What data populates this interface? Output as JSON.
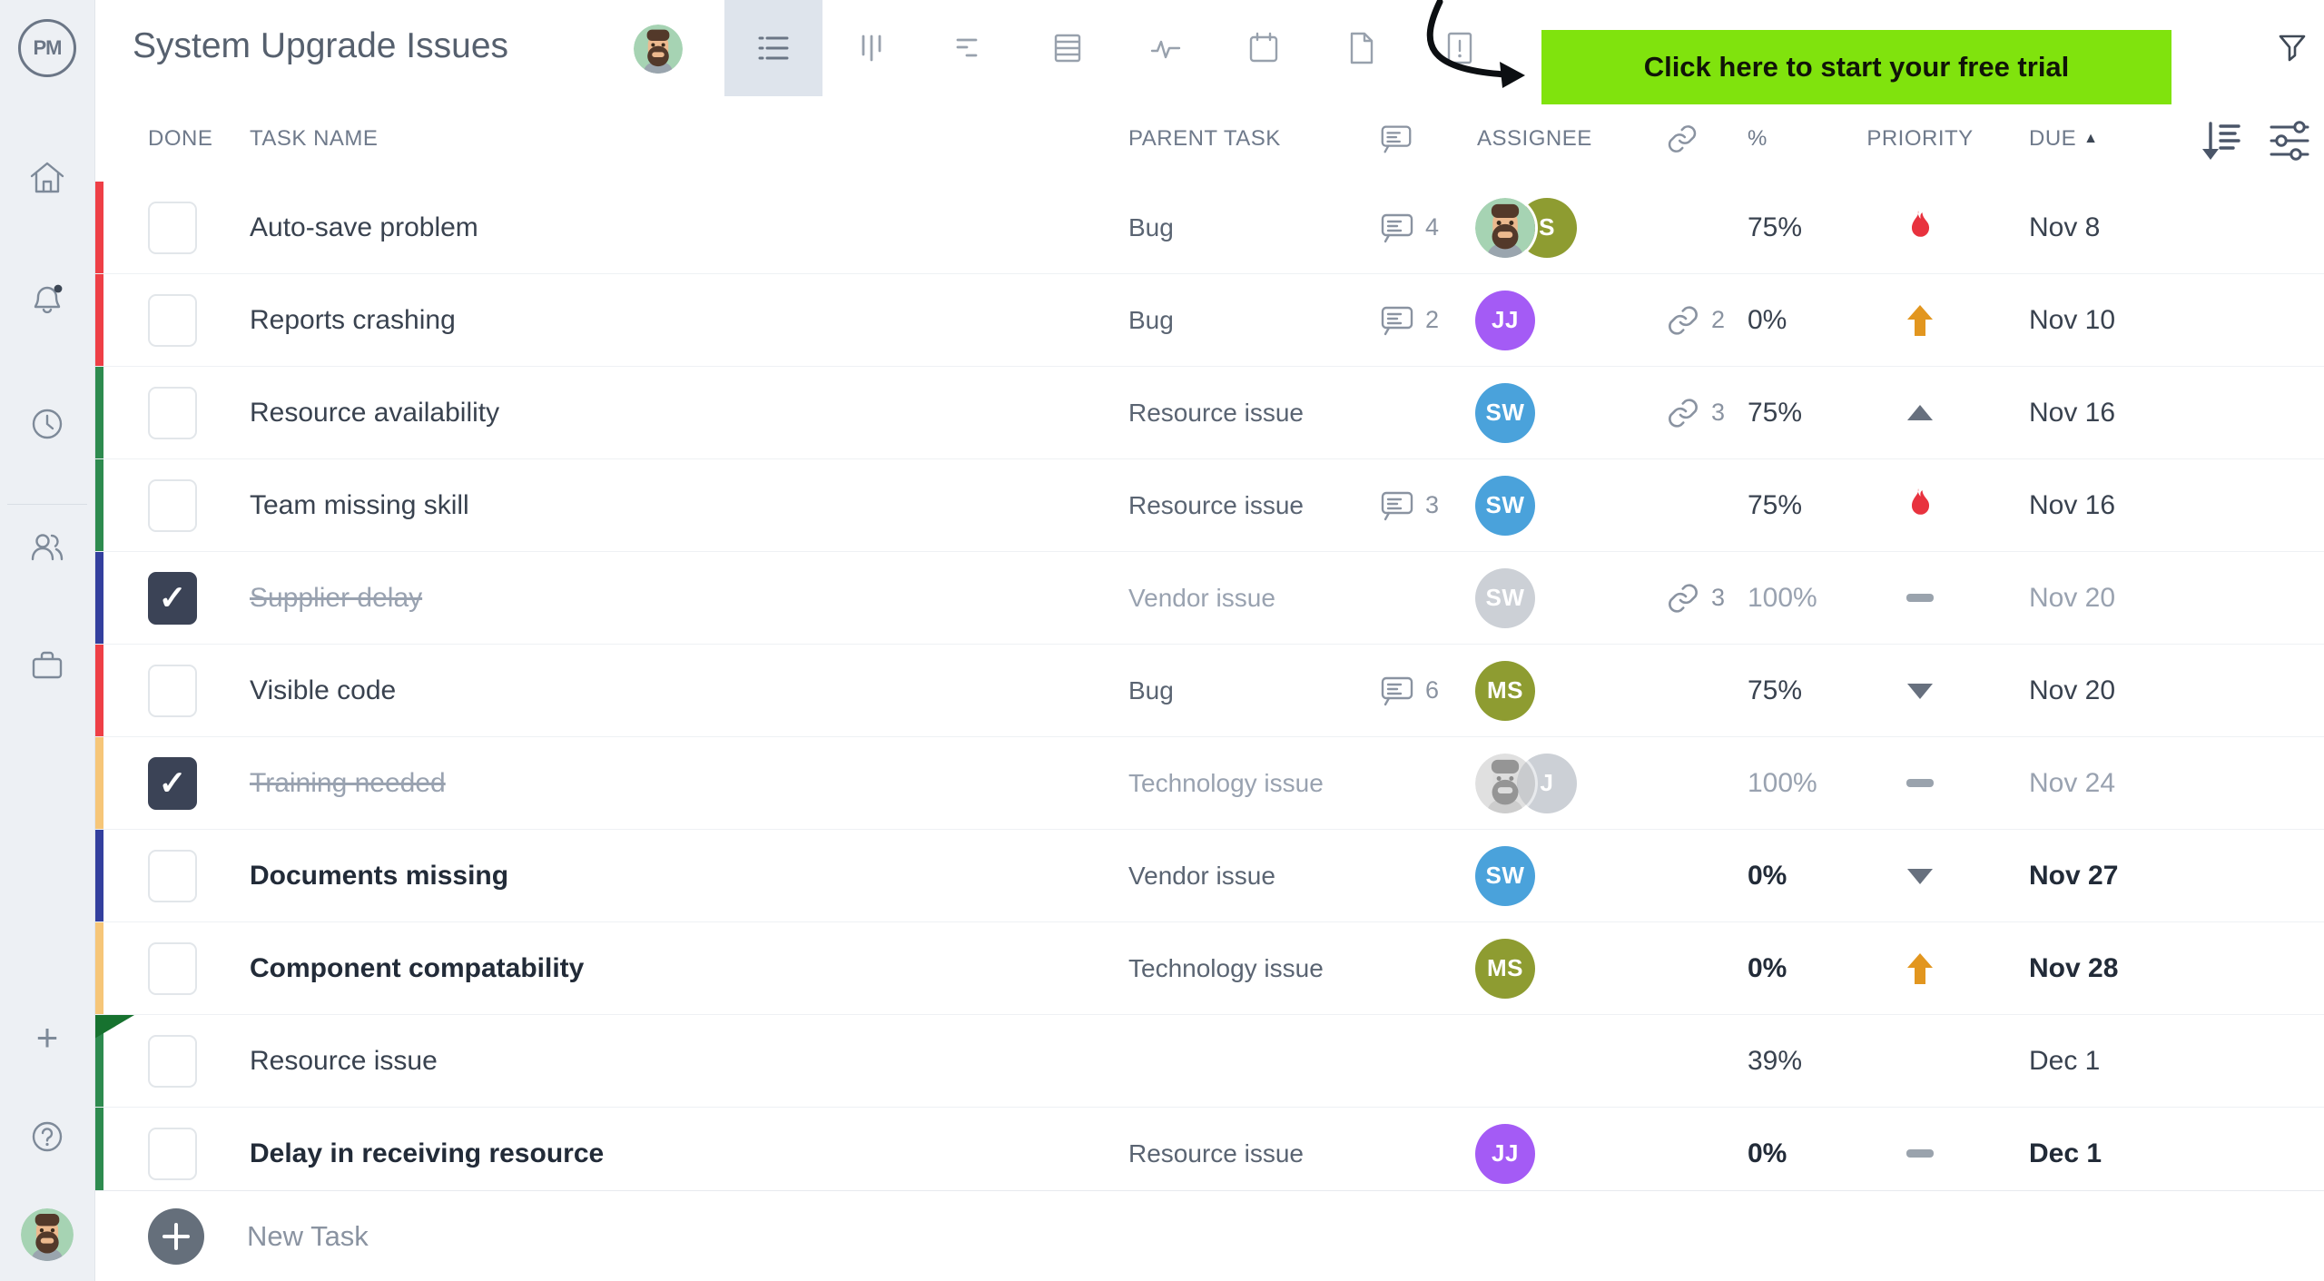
{
  "app": {
    "logo_text": "PM"
  },
  "header": {
    "title": "System Upgrade Issues",
    "banner_label": "Click here to start your free trial",
    "views": [
      {
        "id": "list-view",
        "selected": true
      },
      {
        "id": "board-view",
        "selected": false
      },
      {
        "id": "plan-view",
        "selected": false
      },
      {
        "id": "sheet-view",
        "selected": false
      },
      {
        "id": "activity-view",
        "selected": false
      },
      {
        "id": "calendar-view",
        "selected": false
      },
      {
        "id": "page-view",
        "selected": false
      },
      {
        "id": "issues-view",
        "selected": false
      }
    ]
  },
  "sidebar": {
    "items": [
      "home",
      "notifications",
      "recent",
      "team",
      "portfolio",
      "add",
      "help",
      "profile"
    ]
  },
  "table": {
    "columns": {
      "done": "DONE",
      "task_name": "TASK NAME",
      "parent_task": "PARENT TASK",
      "assignee": "ASSIGNEE",
      "percent": "%",
      "priority": "PRIORITY",
      "due": "DUE"
    },
    "sort": {
      "column": "DUE",
      "direction": "asc"
    },
    "rows": [
      {
        "name": "Auto-save problem",
        "parent": "Bug",
        "done": false,
        "bold": false,
        "bar_color": "#ee3f46",
        "comments": 4,
        "attachments": null,
        "percent": "75%",
        "priority": "urgent",
        "due": "Nov 8",
        "assignees": [
          {
            "kind": "photo",
            "muted": false
          },
          {
            "kind": "initials",
            "text": "S",
            "color": "#8e9c31",
            "muted": false
          }
        ]
      },
      {
        "name": "Reports crashing",
        "parent": "Bug",
        "done": false,
        "bold": false,
        "bar_color": "#ee3f46",
        "comments": 2,
        "attachments": 2,
        "percent": "0%",
        "priority": "high",
        "due": "Nov 10",
        "assignees": [
          {
            "kind": "initials",
            "text": "JJ",
            "color": "#a45bf5",
            "muted": false
          }
        ]
      },
      {
        "name": "Resource availability",
        "parent": "Resource issue",
        "done": false,
        "bold": false,
        "bar_color": "#2e8b4f",
        "comments": null,
        "attachments": 3,
        "percent": "75%",
        "priority": "medium",
        "due": "Nov 16",
        "assignees": [
          {
            "kind": "initials",
            "text": "SW",
            "color": "#4aa2db",
            "muted": false
          }
        ]
      },
      {
        "name": "Team missing skill",
        "parent": "Resource issue",
        "done": false,
        "bold": false,
        "bar_color": "#2e8b4f",
        "comments": 3,
        "attachments": null,
        "percent": "75%",
        "priority": "urgent",
        "due": "Nov 16",
        "assignees": [
          {
            "kind": "initials",
            "text": "SW",
            "color": "#4aa2db",
            "muted": false
          }
        ]
      },
      {
        "name": "Supplier delay",
        "parent": "Vendor issue",
        "done": true,
        "bold": false,
        "bar_color": "#333f9e",
        "comments": null,
        "attachments": 3,
        "percent": "100%",
        "priority": "none",
        "due": "Nov 20",
        "assignees": [
          {
            "kind": "initials",
            "text": "SW",
            "color": "#ccd0d6",
            "muted": true
          }
        ]
      },
      {
        "name": "Visible code",
        "parent": "Bug",
        "done": false,
        "bold": false,
        "bar_color": "#ee3f46",
        "comments": 6,
        "attachments": null,
        "percent": "75%",
        "priority": "low",
        "due": "Nov 20",
        "assignees": [
          {
            "kind": "initials",
            "text": "MS",
            "color": "#8e9c31",
            "muted": false
          }
        ]
      },
      {
        "name": "Training needed",
        "parent": "Technology issue",
        "done": true,
        "bold": false,
        "bar_color": "#f6c678",
        "comments": null,
        "attachments": null,
        "percent": "100%",
        "priority": "none",
        "due": "Nov 24",
        "assignees": [
          {
            "kind": "photo",
            "muted": true
          },
          {
            "kind": "initials",
            "text": "J",
            "color": "#ccd0d6",
            "muted": true
          }
        ]
      },
      {
        "name": "Documents missing",
        "parent": "Vendor issue",
        "done": false,
        "bold": true,
        "bar_color": "#333f9e",
        "comments": null,
        "attachments": null,
        "percent": "0%",
        "priority": "low",
        "due": "Nov 27",
        "assignees": [
          {
            "kind": "initials",
            "text": "SW",
            "color": "#4aa2db",
            "muted": false
          }
        ]
      },
      {
        "name": "Component compatability",
        "parent": "Technology issue",
        "done": false,
        "bold": true,
        "bar_color": "#f6c678",
        "comments": null,
        "attachments": null,
        "percent": "0%",
        "priority": "high",
        "due": "Nov 28",
        "assignees": [
          {
            "kind": "initials",
            "text": "MS",
            "color": "#8e9c31",
            "muted": false
          }
        ]
      },
      {
        "name": "Resource issue",
        "parent": "",
        "done": false,
        "bold": false,
        "bar_color": "#2e8b4f",
        "group_marker": true,
        "comments": null,
        "attachments": null,
        "percent": "39%",
        "priority": null,
        "due": "Dec 1",
        "assignees": []
      },
      {
        "name": "Delay in receiving resource",
        "parent": "Resource issue",
        "done": false,
        "bold": true,
        "bar_color": "#2e8b4f",
        "comments": null,
        "attachments": null,
        "percent": "0%",
        "priority": "none",
        "due": "Dec 1",
        "assignees": [
          {
            "kind": "initials",
            "text": "JJ",
            "color": "#a45bf5",
            "muted": false
          }
        ]
      }
    ]
  },
  "footer": {
    "new_task_label": "New Task"
  },
  "colors": {
    "banner_green": "#80e30d",
    "priority_urgent": "#e8323e",
    "priority_high": "#e2961f",
    "priority_neutral": "#67707e",
    "checkbox_checked": "#3b4356"
  }
}
